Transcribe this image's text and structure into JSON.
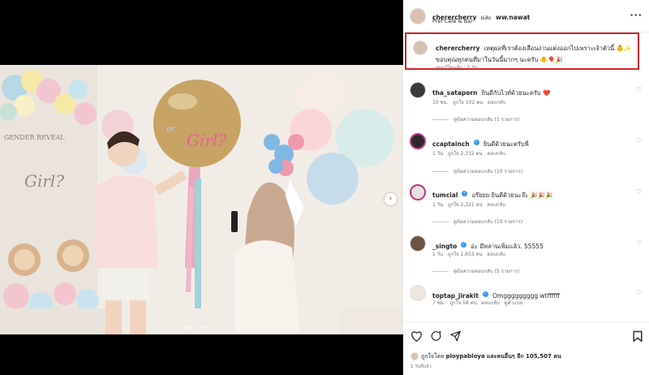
{
  "header": {
    "username": "cherercherry",
    "and_text": "และ",
    "collaborator": "ww.nawat",
    "location": "Préf Café & Bar",
    "more_icon": "more-horizontal-icon"
  },
  "caption": {
    "username": "cherercherry",
    "text": "เหตุผลที่เราต้องเลื่อนงานแต่งออกไปเพราะเจ้าตัวนี้ 👶✨ ขอบคุณทุกคนที่มาในวันนี้มากๆ นะครับ 🐥🎈🎉",
    "meta": "ถูกแก้ไขแล้ว · 1 วัน"
  },
  "comments": [
    {
      "username": "tha_sataporn",
      "verified": false,
      "text": "ยินดีกับไวท์ด้วยนะครับ ❤️",
      "time": "10 ชม.",
      "likes": "ถูกใจ 102 คน",
      "reply": "ตอบกลับ",
      "view_replies": "ดูข้อความตอบกลับ (1 รายการ)",
      "translate": ""
    },
    {
      "username": "ccaptainch",
      "verified": true,
      "text": "ยินดีด้วยนะครับพี่",
      "time": "1 วัน",
      "likes": "ถูกใจ 2,332 คน",
      "reply": "ตอบกลับ",
      "view_replies": "ดูข้อความตอบกลับ (10 รายการ)",
      "translate": ""
    },
    {
      "username": "tumcial",
      "verified": true,
      "text": "อร๊ยยย ยินดีด้วยนะจ๊ะ 🎉🎉🎉",
      "time": "1 วัน",
      "likes": "ถูกใจ 2,321 คน",
      "reply": "ตอบกลับ",
      "view_replies": "ดูข้อความตอบกลับ (19 รายการ)",
      "translate": ""
    },
    {
      "username": "_singto",
      "verified": true,
      "text": "อ่ะ มีหลานเพิ่มแล้ว. 55555",
      "time": "1 วัน",
      "likes": "ถูกใจ 1,653 คน",
      "reply": "ตอบกลับ",
      "view_replies": "ดูข้อความตอบกลับ (5 รายการ)",
      "translate": ""
    },
    {
      "username": "toptap_jirakit",
      "verified": true,
      "text": "Omggggggggg wtffffff",
      "time": "7 ชม.",
      "likes": "ถูกใจ 58 คน",
      "reply": "ตอบกลับ",
      "view_replies": "",
      "translate": "ดูคำแปล"
    }
  ],
  "footer": {
    "liked_by_prefix": "ถูกใจโดย",
    "liked_by_user": "ploypabloya",
    "liked_by_suffix": "และคนอื่นๆ อีก 105,507 คน",
    "time": "1 วันที่แล้ว"
  },
  "photo": {
    "balloon_text": "Girl?",
    "balloon_text2": "or",
    "wall_text": "GENDER REVEAL",
    "wall_text2": "Girl?"
  },
  "carousel": {
    "current": 1,
    "total": 6
  }
}
